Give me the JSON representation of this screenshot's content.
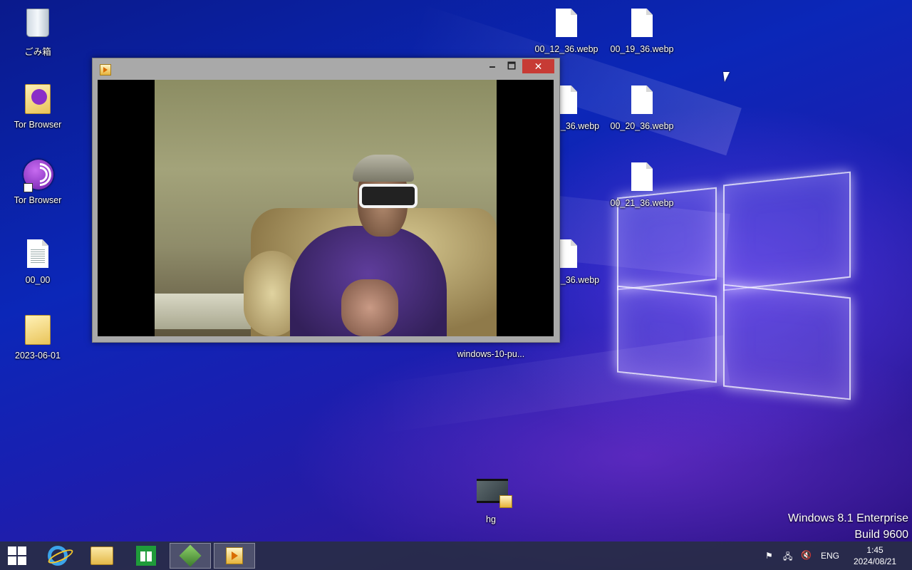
{
  "desktop": {
    "icons_left": [
      {
        "label": "ごみ箱",
        "icon": "recycle-bin-icon"
      },
      {
        "label": "Tor Browser",
        "icon": "folder-tor-icon"
      },
      {
        "label": "Tor Browser",
        "icon": "tor-browser-shortcut-icon"
      },
      {
        "label": "00_00",
        "icon": "text-file-icon"
      },
      {
        "label": "2023-06-01",
        "icon": "folder-icon"
      }
    ],
    "icons_right": [
      {
        "label": "00_12_36.webp",
        "icon": "file-icon"
      },
      {
        "label": "00_19_36.webp",
        "icon": "file-icon"
      },
      {
        "label": "_36.webp",
        "icon": "file-icon"
      },
      {
        "label": "00_20_36.webp",
        "icon": "file-icon"
      },
      {
        "label": "00_21_36.webp",
        "icon": "file-icon"
      },
      {
        "label": "_36.webp",
        "icon": "file-icon"
      },
      {
        "label": "windows-10-pu...",
        "icon": "image-file-icon"
      },
      {
        "label": "hg",
        "icon": "video-file-icon"
      }
    ]
  },
  "player_window": {
    "minimize": "🗕",
    "maximize": "🗖",
    "close": "✕"
  },
  "taskbar": {
    "tray": {
      "language": "ENG"
    },
    "clock": {
      "time": "1:45",
      "date": "2024/08/21"
    }
  },
  "watermark": {
    "line1": "Windows 8.1 Enterprise",
    "line2": "Build 9600"
  },
  "colors": {
    "close_button": "#c73b35",
    "taskbar": "#282c46"
  }
}
